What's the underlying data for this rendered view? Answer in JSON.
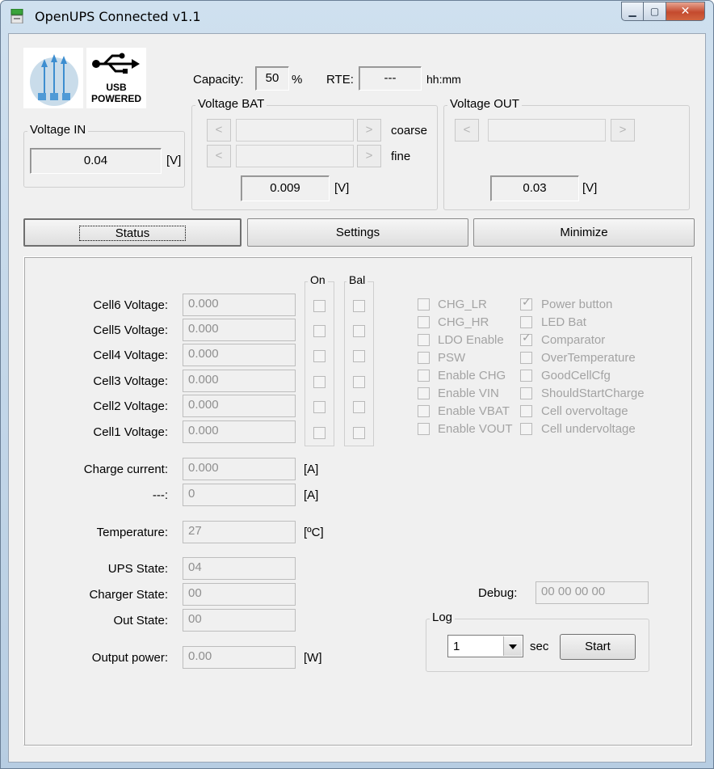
{
  "window": {
    "title": "OpenUPS Connected  v1.1"
  },
  "logo": {
    "usb_text_1": "USB",
    "usb_text_2": "POWERED"
  },
  "header": {
    "capacity_label": "Capacity:",
    "capacity_value": "50",
    "capacity_unit": "%",
    "rte_label": "RTE:",
    "rte_value": "---",
    "rte_unit": "hh:mm"
  },
  "voltage_in": {
    "title": "Voltage IN",
    "value": "0.04",
    "unit": "[V]"
  },
  "voltage_bat": {
    "title": "Voltage BAT",
    "coarse_label": "coarse",
    "fine_label": "fine",
    "left_arrow": "<",
    "right_arrow": ">",
    "value": "0.009",
    "unit": "[V]"
  },
  "voltage_out": {
    "title": "Voltage OUT",
    "left_arrow": "<",
    "right_arrow": ">",
    "value": "0.03",
    "unit": "[V]"
  },
  "tabs": [
    {
      "label": "Status"
    },
    {
      "label": "Settings"
    },
    {
      "label": "Minimize"
    }
  ],
  "cells": {
    "on_title": "On",
    "bal_title": "Bal",
    "rows": [
      {
        "label": "Cell6 Voltage:",
        "value": "0.000"
      },
      {
        "label": "Cell5 Voltage:",
        "value": "0.000"
      },
      {
        "label": "Cell4 Voltage:",
        "value": "0.000"
      },
      {
        "label": "Cell3 Voltage:",
        "value": "0.000"
      },
      {
        "label": "Cell2 Voltage:",
        "value": "0.000"
      },
      {
        "label": "Cell1 Voltage:",
        "value": "0.000"
      }
    ]
  },
  "measurements": {
    "charge_current": {
      "label": "Charge current:",
      "value": "0.000",
      "unit": "[A]"
    },
    "dash": {
      "label": "---:",
      "value": "0",
      "unit": "[A]"
    },
    "temperature": {
      "label": "Temperature:",
      "value": "27",
      "unit": "[ºC]"
    },
    "ups_state": {
      "label": "UPS State:",
      "value": "04"
    },
    "charger_state": {
      "label": "Charger State:",
      "value": "00"
    },
    "out_state": {
      "label": "Out State:",
      "value": "00"
    },
    "output_power": {
      "label": "Output power:",
      "value": "0.00",
      "unit": "[W]"
    }
  },
  "flags_left": [
    {
      "label": "CHG_LR",
      "checked": false
    },
    {
      "label": "CHG_HR",
      "checked": false
    },
    {
      "label": "LDO Enable",
      "checked": false
    },
    {
      "label": "PSW",
      "checked": false
    },
    {
      "label": "Enable CHG",
      "checked": false
    },
    {
      "label": "Enable VIN",
      "checked": false
    },
    {
      "label": "Enable VBAT",
      "checked": false
    },
    {
      "label": "Enable VOUT",
      "checked": false
    }
  ],
  "flags_right": [
    {
      "label": "Power button",
      "checked": true
    },
    {
      "label": "LED Bat",
      "checked": false
    },
    {
      "label": "Comparator",
      "checked": true
    },
    {
      "label": "OverTemperature",
      "checked": false
    },
    {
      "label": "GoodCellCfg",
      "checked": false
    },
    {
      "label": "ShouldStartCharge",
      "checked": false
    },
    {
      "label": "Cell overvoltage",
      "checked": false
    },
    {
      "label": "Cell undervoltage",
      "checked": false
    }
  ],
  "debug": {
    "label": "Debug:",
    "value": "00 00 00 00"
  },
  "log": {
    "title": "Log",
    "interval": "1",
    "unit": "sec",
    "start_label": "Start"
  }
}
